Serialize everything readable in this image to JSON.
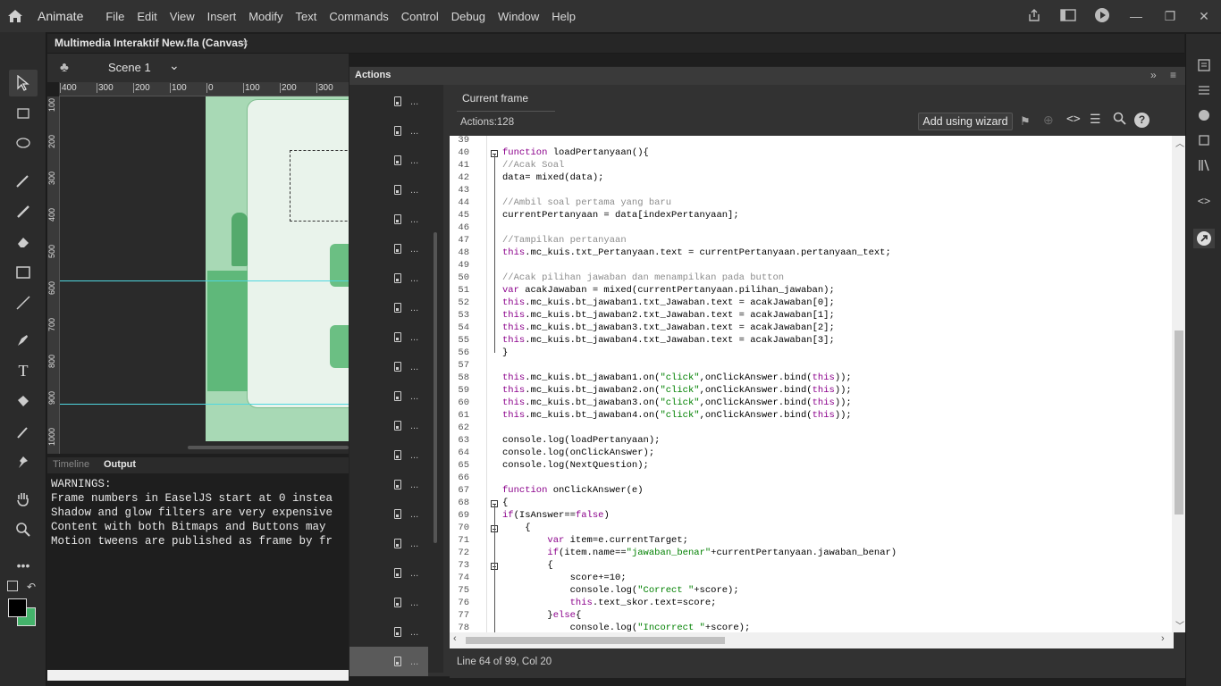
{
  "app": {
    "name": "Animate"
  },
  "menu": [
    "File",
    "Edit",
    "View",
    "Insert",
    "Modify",
    "Text",
    "Commands",
    "Control",
    "Debug",
    "Window",
    "Help"
  ],
  "document": {
    "tab_title": "Multimedia Interaktif New.fla (Canvas)",
    "close": "×"
  },
  "scene": {
    "label": "Scene 1"
  },
  "ruler": {
    "h_ticks": [
      "400",
      "300",
      "200",
      "100",
      "0",
      "100",
      "200",
      "300"
    ],
    "v_ticks": [
      "100",
      "200",
      "300",
      "400",
      "500",
      "600",
      "700",
      "800",
      "900",
      "1000"
    ]
  },
  "panel_tabs": {
    "timeline": "Timeline",
    "output": "Output"
  },
  "output_lines": [
    "WARNINGS:",
    "Frame numbers in EaselJS start at 0 instea",
    "Shadow and glow filters are very expensive",
    "Content with both Bitmaps and Buttons may",
    "Motion tweens are published as frame by fr"
  ],
  "actions": {
    "panel_title": "Actions",
    "current_frame": "Current frame",
    "actions_count": "Actions:128",
    "wizard_button": "Add using wizard",
    "status": "Line 64 of 99, Col 20",
    "frame_dots": "..."
  },
  "code_lines": [
    {
      "n": "39",
      "t": ""
    },
    {
      "n": "40",
      "t": "function loadPertanyaan(){"
    },
    {
      "n": "41",
      "t": "//Acak Soal"
    },
    {
      "n": "42",
      "t": "data= mixed(data);"
    },
    {
      "n": "43",
      "t": ""
    },
    {
      "n": "44",
      "t": "//Ambil soal pertama yang baru"
    },
    {
      "n": "45",
      "t": "currentPertanyaan = data[indexPertanyaan];"
    },
    {
      "n": "46",
      "t": ""
    },
    {
      "n": "47",
      "t": "//Tampilkan pertanyaan"
    },
    {
      "n": "48",
      "t": "this.mc_kuis.txt_Pertanyaan.text = currentPertanyaan.pertanyaan_text;"
    },
    {
      "n": "49",
      "t": ""
    },
    {
      "n": "50",
      "t": "//Acak pilihan jawaban dan menampilkan pada button"
    },
    {
      "n": "51",
      "t": "var acakJawaban = mixed(currentPertanyaan.pilihan_jawaban);"
    },
    {
      "n": "52",
      "t": "this.mc_kuis.bt_jawaban1.txt_Jawaban.text = acakJawaban[0];"
    },
    {
      "n": "53",
      "t": "this.mc_kuis.bt_jawaban2.txt_Jawaban.text = acakJawaban[1];"
    },
    {
      "n": "54",
      "t": "this.mc_kuis.bt_jawaban3.txt_Jawaban.text = acakJawaban[2];"
    },
    {
      "n": "55",
      "t": "this.mc_kuis.bt_jawaban4.txt_Jawaban.text = acakJawaban[3];"
    },
    {
      "n": "56",
      "t": "}"
    },
    {
      "n": "57",
      "t": ""
    },
    {
      "n": "58",
      "t": "this.mc_kuis.bt_jawaban1.on(\"click\",onClickAnswer.bind(this));"
    },
    {
      "n": "59",
      "t": "this.mc_kuis.bt_jawaban2.on(\"click\",onClickAnswer.bind(this));"
    },
    {
      "n": "60",
      "t": "this.mc_kuis.bt_jawaban3.on(\"click\",onClickAnswer.bind(this));"
    },
    {
      "n": "61",
      "t": "this.mc_kuis.bt_jawaban4.on(\"click\",onClickAnswer.bind(this));"
    },
    {
      "n": "62",
      "t": ""
    },
    {
      "n": "63",
      "t": "console.log(loadPertanyaan);"
    },
    {
      "n": "64",
      "t": "console.log(onClickAnswer);"
    },
    {
      "n": "65",
      "t": "console.log(NextQuestion);"
    },
    {
      "n": "66",
      "t": ""
    },
    {
      "n": "67",
      "t": "function onClickAnswer(e)"
    },
    {
      "n": "68",
      "t": "{"
    },
    {
      "n": "69",
      "t": "if(IsAnswer==false)"
    },
    {
      "n": "70",
      "t": "    {"
    },
    {
      "n": "71",
      "t": "        var item=e.currentTarget;"
    },
    {
      "n": "72",
      "t": "        if(item.name==\"jawaban_benar\"+currentPertanyaan.jawaban_benar)"
    },
    {
      "n": "73",
      "t": "        {"
    },
    {
      "n": "74",
      "t": "            score+=10;"
    },
    {
      "n": "75",
      "t": "            console.log(\"Correct \"+score);"
    },
    {
      "n": "76",
      "t": "            this.text_skor.text=score;"
    },
    {
      "n": "77",
      "t": "        }else{"
    },
    {
      "n": "78",
      "t": "            console.log(\"Incorrect \"+score);"
    }
  ]
}
